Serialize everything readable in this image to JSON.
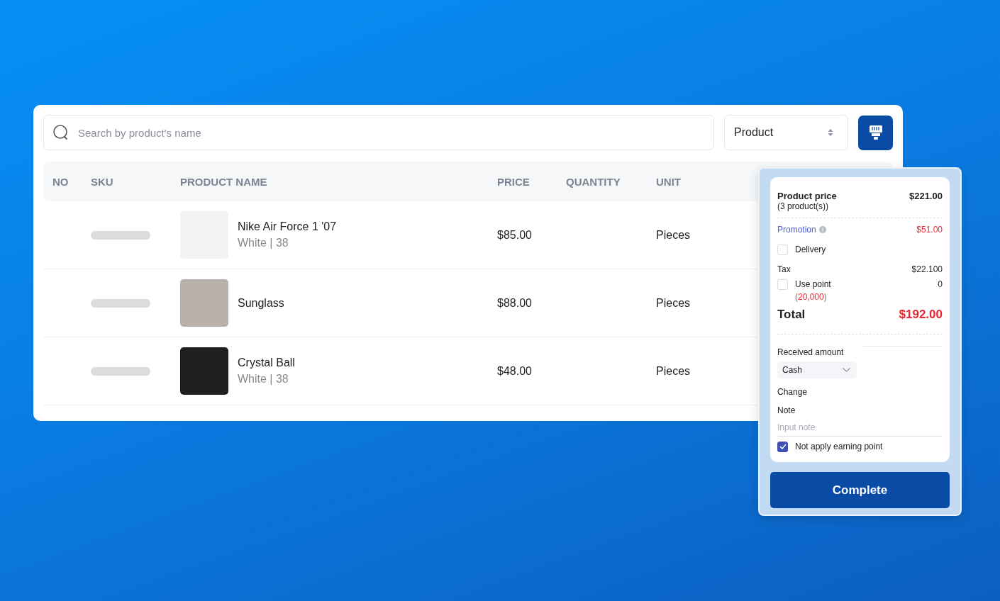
{
  "search": {
    "placeholder": "Search by product's name"
  },
  "filter": {
    "value": "Product"
  },
  "table": {
    "columns": [
      "NO",
      "SKU",
      "PRODUCT NAME",
      "PRICE",
      "QUANTITY",
      "UNIT"
    ],
    "rows": [
      {
        "name": "Nike Air Force 1 '07",
        "variant": "White | 38",
        "price": "$85.00",
        "unit": "Pieces"
      },
      {
        "name": "Sunglass",
        "price": "$88.00",
        "unit": "Pieces"
      },
      {
        "name": "Crystal Ball",
        "variant": "White | 38",
        "price": "$48.00",
        "unit": "Pieces"
      }
    ]
  },
  "checkout": {
    "product_price": {
      "label": "Product price",
      "count": "(3 product(s))",
      "value": "$221.00"
    },
    "promotion": {
      "label": "Promotion",
      "value": "$51.00"
    },
    "delivery": {
      "label": "Delivery",
      "checked": false
    },
    "tax": {
      "label": "Tax",
      "value": "$22.100"
    },
    "use_point": {
      "label": "Use point",
      "checked": false,
      "open": "(",
      "balance": "20,000",
      "close": ")",
      "value": "0"
    },
    "total": {
      "label": "Total",
      "value": "$192.00"
    },
    "received": {
      "label": "Received amount",
      "method": "Cash"
    },
    "change": {
      "label": "Change"
    },
    "note": {
      "label": "Note",
      "placeholder": "Input note"
    },
    "no_earning": {
      "label": "Not apply earning point",
      "checked": true
    },
    "button": "Complete"
  }
}
